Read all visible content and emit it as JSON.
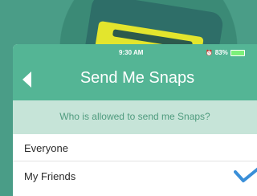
{
  "status_bar": {
    "time": "9:30 AM",
    "alarm_icon": "alarm-icon",
    "battery_percent": "83%",
    "battery_icon": "battery-icon"
  },
  "nav": {
    "back_icon": "back-arrow-icon",
    "title": "Send Me Snaps"
  },
  "prompt": {
    "text": "Who is allowed to send me Snaps?"
  },
  "options": [
    {
      "label": "Everyone",
      "selected": false
    },
    {
      "label": "My Friends",
      "selected": true
    }
  ],
  "colors": {
    "header": "#54b595",
    "prompt_background": "#c6e4d8",
    "prompt_text": "#4f9b7e",
    "checkmark": "#3a8fd8",
    "backdrop": "#4a9d87",
    "card": "#e3e52d"
  }
}
